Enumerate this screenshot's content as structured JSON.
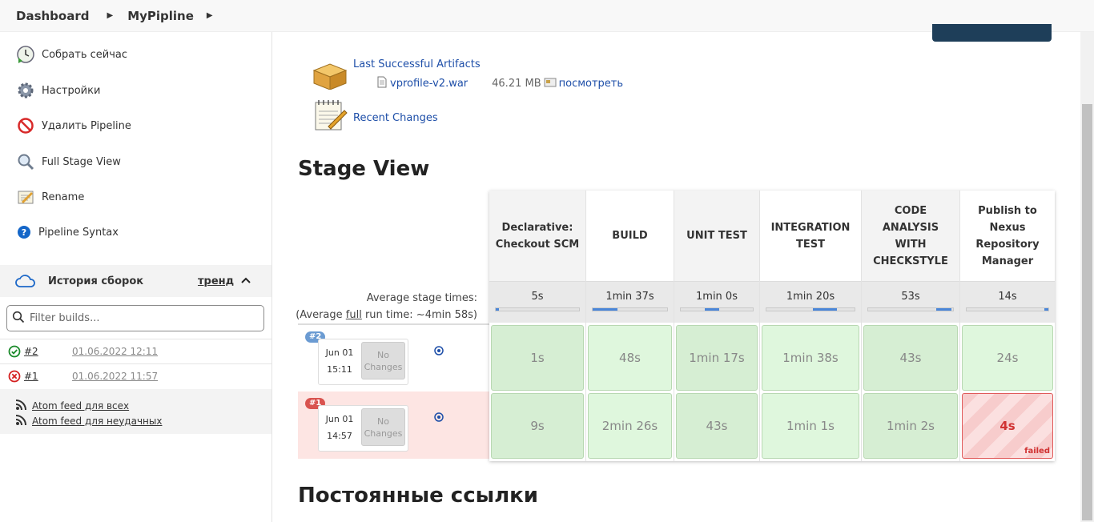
{
  "breadcrumb": [
    "Dashboard",
    "MyPipline"
  ],
  "sidebar": {
    "tasks": [
      {
        "label": "Собрать сейчас",
        "icon": "clock-play-icon"
      },
      {
        "label": "Настройки",
        "icon": "gear-icon"
      },
      {
        "label": "Удалить Pipeline",
        "icon": "no-entry-icon"
      },
      {
        "label": "Full Stage View",
        "icon": "magnifier-icon"
      },
      {
        "label": "Rename",
        "icon": "notepad-icon"
      },
      {
        "label": "Pipeline Syntax",
        "icon": "help-icon"
      }
    ],
    "history": {
      "title": "История сборок",
      "trend": "тренд",
      "filter_placeholder": "Filter builds...",
      "builds": [
        {
          "number": "#2",
          "date": "01.06.2022 12:11",
          "status": "success"
        },
        {
          "number": "#1",
          "date": "01.06.2022 11:57",
          "status": "failed"
        }
      ],
      "feeds": [
        "Atom feed для всех",
        "Atom feed для неудачных"
      ]
    }
  },
  "artifacts": {
    "title": "Last Successful Artifacts",
    "file": "vprofile-v2.war",
    "size": "46.21 MB",
    "view": "посмотреть",
    "recent_changes": "Recent Changes"
  },
  "stage_view": {
    "title": "Stage View",
    "avg_stage_label": "Average stage times:",
    "avg_run_prefix": "(Average ",
    "avg_run_link": "full",
    "avg_run_suffix": " run time: ~4min 58s)",
    "stages": [
      {
        "name": "Declarative: Checkout SCM",
        "avg": "5s",
        "avg_fill_pct": 4,
        "avg_fill_start_pct": 0
      },
      {
        "name": "BUILD",
        "avg": "1min 37s",
        "avg_fill_pct": 33,
        "avg_fill_start_pct": 0
      },
      {
        "name": "UNIT TEST",
        "avg": "1min 0s",
        "avg_fill_pct": 20,
        "avg_fill_start_pct": 33
      },
      {
        "name": "INTEGRATION TEST",
        "avg": "1min 20s",
        "avg_fill_pct": 27,
        "avg_fill_start_pct": 53
      },
      {
        "name": "CODE ANALYSIS WITH CHECKSTYLE",
        "avg": "53s",
        "avg_fill_pct": 18,
        "avg_fill_start_pct": 80
      },
      {
        "name": "Publish to Nexus Repository Manager",
        "avg": "14s",
        "avg_fill_pct": 5,
        "avg_fill_start_pct": 95
      }
    ],
    "runs": [
      {
        "badge": "#2",
        "date": "Jun 01",
        "time": "15:11",
        "changes": "No Changes",
        "status": "success",
        "durations": [
          "1s",
          "48s",
          "1min 17s",
          "1min 38s",
          "43s",
          "24s"
        ]
      },
      {
        "badge": "#1",
        "date": "Jun 01",
        "time": "14:57",
        "changes": "No Changes",
        "status": "failed",
        "durations": [
          "9s",
          "2min 26s",
          "43s",
          "1min 1s",
          "1min 2s",
          "4s"
        ],
        "failed_index": 5,
        "failed_label": "failed"
      }
    ]
  },
  "permalinks_title": "Постоянные ссылки",
  "colors": {
    "success_cell": "#dff7dd",
    "success_cell_alt": "#d2edd0",
    "failed_row": "#fde5e3",
    "badge_success": "#6b9bd2",
    "badge_failed": "#d9534f",
    "link": "#1d4ea8"
  }
}
